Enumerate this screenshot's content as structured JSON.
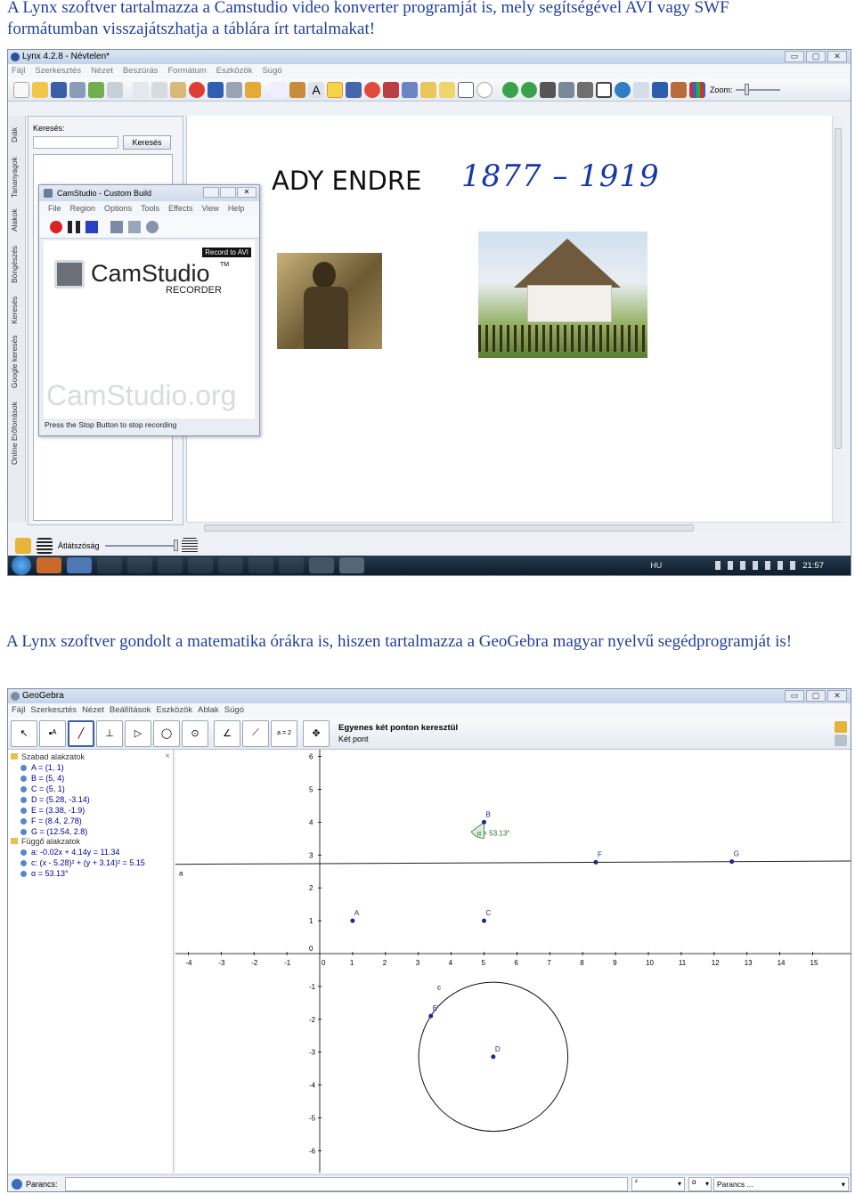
{
  "caption1": {
    "line1": "A Lynx szoftver tartalmazza a Camstudio video konverter programját is, mely segítségével AVI vagy SWF",
    "line2": "formátumban visszajátszhatja a táblára írt tartalmakat!"
  },
  "caption2": "A Lynx szoftver gondolt a matematika órákra is, hiszen tartalmazza a GeoGebra magyar nyelvű segédprogramját is!",
  "lynx": {
    "title": "Lynx 4.2.8 - Névtelen*",
    "menu": [
      "Fájl",
      "Szerkesztés",
      "Nézet",
      "Beszúrás",
      "Formátum",
      "Eszközök",
      "Súgó"
    ],
    "zoom_label": "Zoom:",
    "side_tabs": [
      "Diák",
      "Tananyagok",
      "Alakok",
      "Böngészés",
      "Keresés",
      "Google keresés",
      "Online Erőforrások"
    ],
    "search_label": "Keresés:",
    "search_button": "Keresés",
    "board_title": "ADY ENDRE",
    "board_years": "1877 – 1919",
    "transparency_label": "Átlátszóság",
    "taskbar": {
      "lang": "HU",
      "time": "21:57"
    }
  },
  "camstudio": {
    "title": "CamStudio - Custom Build",
    "menu": [
      "File",
      "Region",
      "Options",
      "Tools",
      "Effects",
      "View",
      "Help"
    ],
    "badge": "Record to AVI",
    "brand": "CamStudio",
    "tm": "TM",
    "sub": "RECORDER",
    "watermark": "CamStudio.org",
    "status": "Press the Stop Button to stop recording"
  },
  "geogebra": {
    "title": "GeoGebra",
    "menu": [
      "Fájl",
      "Szerkesztés",
      "Nézet",
      "Beállítások",
      "Eszközök",
      "Ablak",
      "Súgó"
    ],
    "tool_title": "Egyenes két ponton keresztül",
    "tool_sub": "Két pont",
    "tool_slider_label": "a = 2",
    "free_header": "Szabad alakzatok",
    "free_items": [
      "A = (1, 1)",
      "B = (5, 4)",
      "C = (5, 1)",
      "D = (5.28, -3.14)",
      "E = (3.38, -1.9)",
      "F = (8.4, 2.78)",
      "G = (12.54, 2.8)"
    ],
    "dep_header": "Függő alakzatok",
    "dep_items": [
      "a: -0.02x + 4.14y = 11.34",
      "c: (x - 5.28)² + (y + 3.14)² = 5.15",
      "α = 53.13°"
    ],
    "angle_label": "α = 53.13°",
    "command_label": "Parancs:",
    "cmd_dd1": "²",
    "cmd_dd2": "α",
    "cmd_dd3": "Parancs ...",
    "x_ticks": [
      "-4",
      "-3",
      "-2",
      "-1",
      "0",
      "1",
      "2",
      "3",
      "4",
      "5",
      "6",
      "7",
      "8",
      "9",
      "10",
      "11",
      "12",
      "13",
      "14",
      "15"
    ],
    "y_ticks": [
      "6",
      "5",
      "4",
      "3",
      "2",
      "1",
      "-1",
      "-2",
      "-3",
      "-4",
      "-5",
      "-6"
    ],
    "line_label": "a",
    "circle_label": "c",
    "points": [
      {
        "name": "A",
        "x": 1,
        "y": 1
      },
      {
        "name": "B",
        "x": 5,
        "y": 4
      },
      {
        "name": "C",
        "x": 5,
        "y": 1
      },
      {
        "name": "D",
        "x": 5.28,
        "y": -3.14
      },
      {
        "name": "E",
        "x": 3.38,
        "y": -1.9
      },
      {
        "name": "F",
        "x": 8.4,
        "y": 2.78
      },
      {
        "name": "G",
        "x": 12.54,
        "y": 2.8
      }
    ],
    "circle": {
      "cx": 5.28,
      "cy": -3.14,
      "r2": 5.15
    },
    "line": {
      "a": -0.02,
      "b": 4.14,
      "c": 11.34
    }
  }
}
